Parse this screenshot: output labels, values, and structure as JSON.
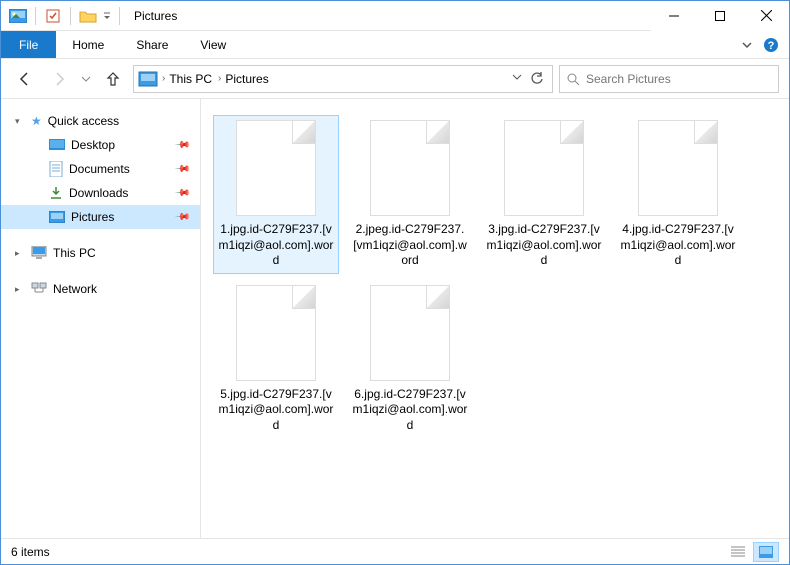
{
  "window": {
    "title": "Pictures"
  },
  "ribbon": {
    "file": "File",
    "tabs": [
      "Home",
      "Share",
      "View"
    ]
  },
  "breadcrumb": {
    "segments": [
      "This PC",
      "Pictures"
    ]
  },
  "search": {
    "placeholder": "Search Pictures"
  },
  "sidebar": {
    "quick_access": "Quick access",
    "items": [
      {
        "label": "Desktop",
        "icon": "desktop",
        "pinned": true
      },
      {
        "label": "Documents",
        "icon": "documents",
        "pinned": true
      },
      {
        "label": "Downloads",
        "icon": "downloads",
        "pinned": true
      },
      {
        "label": "Pictures",
        "icon": "pictures",
        "pinned": true,
        "selected": true
      }
    ],
    "this_pc": "This PC",
    "network": "Network"
  },
  "files": [
    {
      "name": "1.jpg.id-C279F237.[vm1iqzi@aol.com].word",
      "selected": true
    },
    {
      "name": "2.jpeg.id-C279F237.[vm1iqzi@aol.com].word"
    },
    {
      "name": "3.jpg.id-C279F237.[vm1iqzi@aol.com].word"
    },
    {
      "name": "4.jpg.id-C279F237.[vm1iqzi@aol.com].word"
    },
    {
      "name": "5.jpg.id-C279F237.[vm1iqzi@aol.com].word"
    },
    {
      "name": "6.jpg.id-C279F237.[vm1iqzi@aol.com].word"
    }
  ],
  "status": {
    "text": "6 items"
  }
}
